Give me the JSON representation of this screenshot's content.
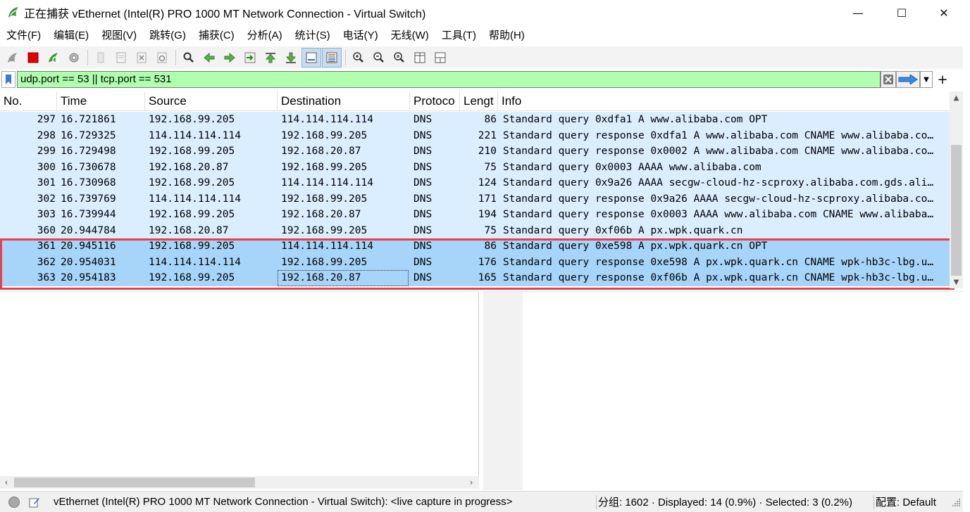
{
  "window": {
    "title": "正在捕获 vEthernet (Intel(R) PRO 1000 MT Network Connection - Virtual Switch)",
    "logo_icon": "wireshark-fin-icon",
    "minimize": "—",
    "maximize": "☐",
    "close": "✕"
  },
  "menu": [
    {
      "label": "文件(F)"
    },
    {
      "label": "编辑(E)"
    },
    {
      "label": "视图(V)"
    },
    {
      "label": "跳转(G)"
    },
    {
      "label": "捕获(C)"
    },
    {
      "label": "分析(A)"
    },
    {
      "label": "统计(S)"
    },
    {
      "label": "电话(Y)"
    },
    {
      "label": "无线(W)"
    },
    {
      "label": "工具(T)"
    },
    {
      "label": "帮助(H)"
    }
  ],
  "toolbar": [
    "start-capture-icon",
    "stop-capture-icon",
    "restart-capture-icon",
    "capture-options-icon",
    "open-file-icon",
    "save-file-icon",
    "close-file-icon",
    "reload-file-icon",
    "find-packet-icon",
    "go-back-icon",
    "go-forward-icon",
    "go-to-packet-icon",
    "go-first-icon",
    "go-last-icon",
    "auto-scroll-icon",
    "colorize-icon",
    "zoom-in-icon",
    "zoom-out-icon",
    "zoom-normal-icon",
    "resize-columns-icon",
    "layout-icon"
  ],
  "filter": {
    "value": "udp.port == 53 || tcp.port == 531",
    "background": "#afffaf"
  },
  "columns": {
    "no": "No.",
    "time": "Time",
    "source": "Source",
    "destination": "Destination",
    "protocol": "Protoco",
    "length": "Lengt",
    "info": "Info"
  },
  "packets": [
    {
      "no": "297",
      "time": "16.721861",
      "src": "192.168.99.205",
      "dst": "114.114.114.114",
      "proto": "DNS",
      "len": "86",
      "info": "Standard query 0xdfa1 A www.alibaba.com OPT"
    },
    {
      "no": "298",
      "time": "16.729325",
      "src": "114.114.114.114",
      "dst": "192.168.99.205",
      "proto": "DNS",
      "len": "221",
      "info": "Standard query response 0xdfa1 A www.alibaba.com CNAME www.alibaba.co…"
    },
    {
      "no": "299",
      "time": "16.729498",
      "src": "192.168.99.205",
      "dst": "192.168.20.87",
      "proto": "DNS",
      "len": "210",
      "info": "Standard query response 0x0002 A www.alibaba.com CNAME www.alibaba.co…"
    },
    {
      "no": "300",
      "time": "16.730678",
      "src": "192.168.20.87",
      "dst": "192.168.99.205",
      "proto": "DNS",
      "len": "75",
      "info": "Standard query 0x0003 AAAA www.alibaba.com"
    },
    {
      "no": "301",
      "time": "16.730968",
      "src": "192.168.99.205",
      "dst": "114.114.114.114",
      "proto": "DNS",
      "len": "124",
      "info": "Standard query 0x9a26 AAAA secgw-cloud-hz-scproxy.alibaba.com.gds.ali…"
    },
    {
      "no": "302",
      "time": "16.739769",
      "src": "114.114.114.114",
      "dst": "192.168.99.205",
      "proto": "DNS",
      "len": "171",
      "info": "Standard query response 0x9a26 AAAA secgw-cloud-hz-scproxy.alibaba.co…"
    },
    {
      "no": "303",
      "time": "16.739944",
      "src": "192.168.99.205",
      "dst": "192.168.20.87",
      "proto": "DNS",
      "len": "194",
      "info": "Standard query response 0x0003 AAAA www.alibaba.com CNAME www.alibaba…"
    },
    {
      "no": "360",
      "time": "20.944784",
      "src": "192.168.20.87",
      "dst": "192.168.99.205",
      "proto": "DNS",
      "len": "75",
      "info": "Standard query 0xf06b A px.wpk.quark.cn"
    },
    {
      "no": "361",
      "time": "20.945116",
      "src": "192.168.99.205",
      "dst": "114.114.114.114",
      "proto": "DNS",
      "len": "86",
      "info": "Standard query 0xe598 A px.wpk.quark.cn OPT",
      "selected": true
    },
    {
      "no": "362",
      "time": "20.954031",
      "src": "114.114.114.114",
      "dst": "192.168.99.205",
      "proto": "DNS",
      "len": "176",
      "info": "Standard query response 0xe598 A px.wpk.quark.cn CNAME wpk-hb3c-lbg.u…",
      "selected": true
    },
    {
      "no": "363",
      "time": "20.954183",
      "src": "192.168.99.205",
      "dst": "192.168.20.87",
      "proto": "DNS",
      "len": "165",
      "info": "Standard query response 0xf06b A px.wpk.quark.cn CNAME wpk-hb3c-lbg.u…",
      "selected": true
    }
  ],
  "colors": {
    "row_normal": "#daeeff",
    "row_selected": "#a7d4f9",
    "highlight_box": "#e8404a"
  },
  "status": {
    "interface": "vEthernet (Intel(R) PRO 1000 MT Network Connection - Virtual Switch): <live capture in progress>",
    "stats": "分组: 1602 · Displayed: 14 (0.9%) · Selected: 3 (0.2%)",
    "profile": "配置: Default"
  }
}
